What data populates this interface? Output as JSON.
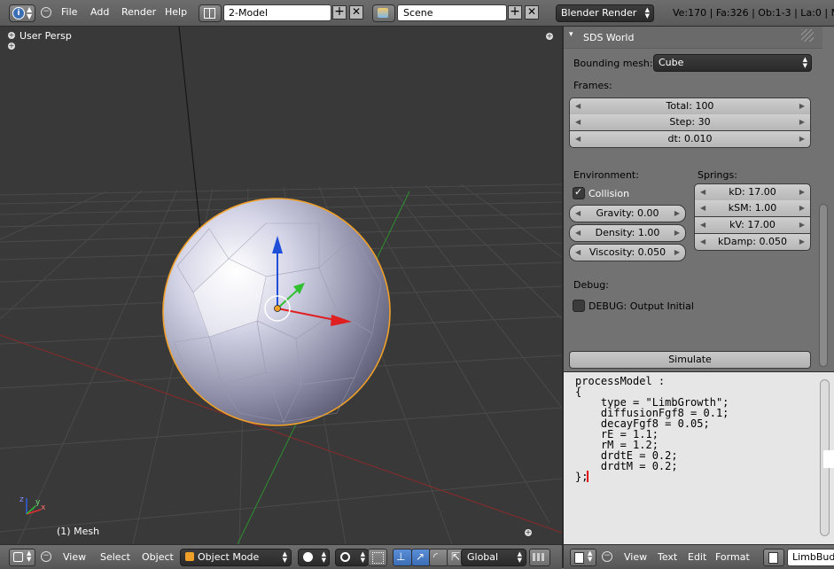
{
  "top_header": {
    "menus": [
      "File",
      "Add",
      "Render",
      "Help"
    ],
    "screen_layout": "2-Model",
    "scene": "Scene",
    "render_engine": "Blender Render",
    "stats": "Ve:170 | Fa:326 | Ob:1-3 | La:0 | Me"
  },
  "viewport": {
    "view_name": "User Persp",
    "object_label": "(1) Mesh",
    "axis_labels": {
      "x": "x",
      "y": "y",
      "z": "z"
    }
  },
  "viewport_header": {
    "menus": [
      "View",
      "Select",
      "Object"
    ],
    "mode": "Object Mode",
    "orientation": "Global"
  },
  "properties": {
    "panel_title": "SDS World",
    "bounding_mesh_label": "Bounding mesh:",
    "bounding_mesh_value": "Cube",
    "frames_label": "Frames:",
    "frames": [
      "Total: 100",
      "Step: 30",
      "dt: 0.010"
    ],
    "environment_label": "Environment:",
    "collision_label": "Collision",
    "collision_checked": true,
    "environment_fields": [
      "Gravity: 0.00",
      "Density: 1.00",
      "Viscosity: 0.050"
    ],
    "springs_label": "Springs:",
    "springs": [
      "kD: 17.00",
      "kSM: 1.00",
      "kV: 17.00",
      "kDamp: 0.050"
    ],
    "debug_label": "Debug:",
    "debug_option": "DEBUG: Output Initial",
    "debug_checked": false,
    "simulate_button": "Simulate"
  },
  "text_editor": {
    "lines": [
      "processModel :",
      "{",
      "    type = \"LimbGrowth\";",
      "    diffusionFgf8 = 0.1;",
      "    decayFgf8 = 0.05;",
      "    rE = 1.1;",
      "    rM = 1.2;",
      "    drdtE = 0.2;",
      "    drdtM = 0.2;",
      "};"
    ]
  },
  "text_editor_header": {
    "menus": [
      "View",
      "Text",
      "Edit",
      "Format"
    ],
    "text_name": "LimbBud"
  },
  "colors": {
    "viewport_bg": "#393939",
    "selection_outline": "#f0a028",
    "axis_x": "#e03030",
    "axis_y": "#30c030",
    "axis_z": "#2050e0"
  }
}
